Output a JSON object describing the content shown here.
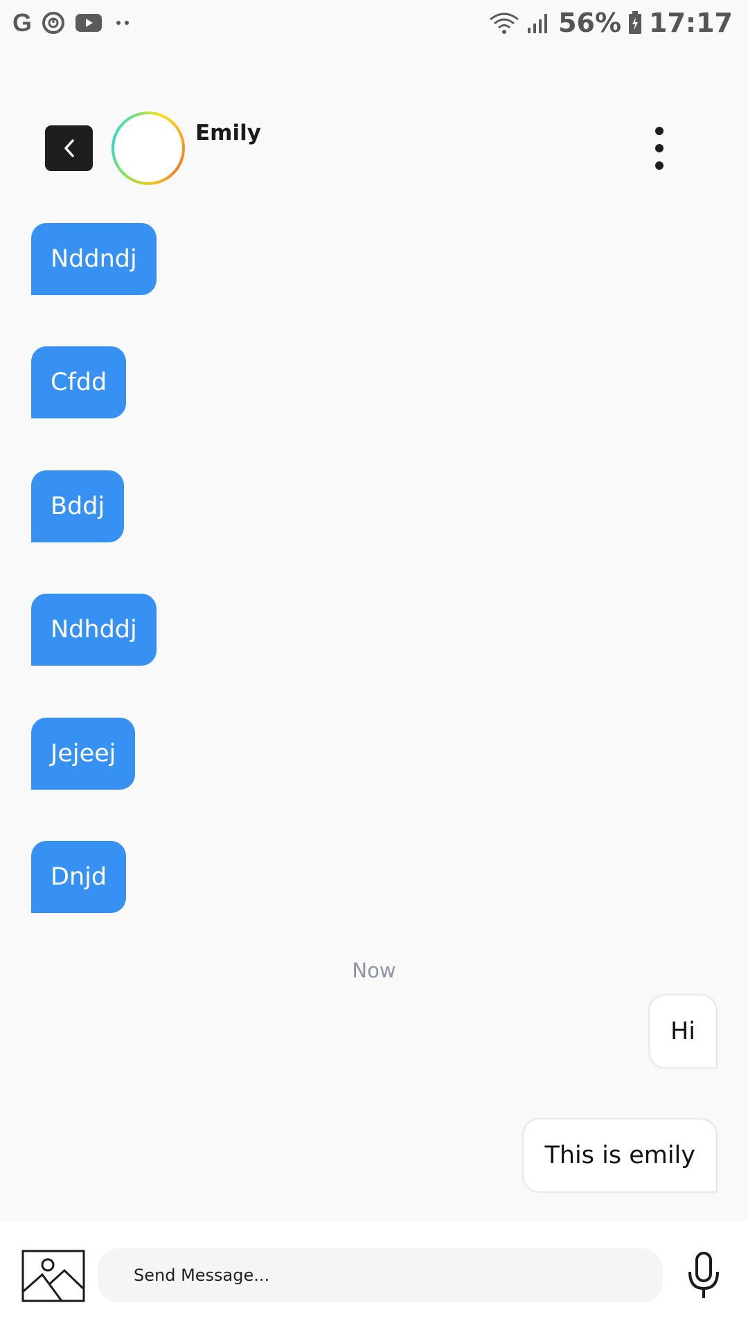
{
  "status_bar": {
    "left_icons": [
      "google-icon",
      "sync-icon",
      "youtube-icon",
      "more-dots-icon"
    ],
    "battery": "56%",
    "time": "17:17"
  },
  "header": {
    "contact_name": "Emily"
  },
  "messages": {
    "incoming": [
      "Nddndj",
      "Cfdd",
      "Bddj",
      "Ndhddj",
      "Jejeej",
      "Dnjd"
    ],
    "timestamp": "Now",
    "outgoing": [
      "Hi",
      "This is emily"
    ]
  },
  "composer": {
    "placeholder": "Send Message..."
  },
  "colors": {
    "incoming_bubble": "#3691f2",
    "background": "#f9f9f9",
    "back_button": "#1e1e1e"
  }
}
